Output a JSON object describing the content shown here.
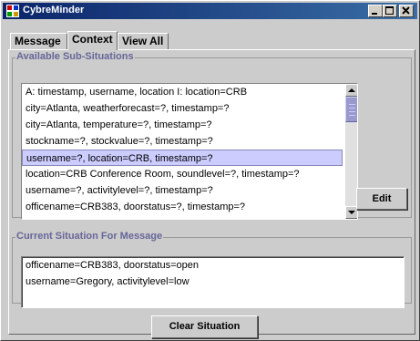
{
  "window": {
    "title": "CybreMinder",
    "icon": "app-logo-icon"
  },
  "tabs": [
    {
      "label": "Message",
      "active": false
    },
    {
      "label": "Context",
      "active": true
    },
    {
      "label": "View All",
      "active": false
    }
  ],
  "available": {
    "title": "Available Sub-Situations",
    "items": [
      "A: timestamp, username, location I: location=CRB",
      "city=Atlanta, weatherforecast=?, timestamp=?",
      "city=Atlanta, temperature=?, timestamp=?",
      "stockname=?, stockvalue=?, timestamp=?",
      "username=?, location=CRB, timestamp=?",
      "location=CRB Conference Room, soundlevel=?, timestamp=?",
      "username=?, activitylevel=?, timestamp=?",
      "officename=CRB383, doorstatus=?, timestamp=?"
    ],
    "selected_index": 4,
    "edit_label": "Edit"
  },
  "current": {
    "title": "Current Situation For Message",
    "lines": [
      "officename=CRB383, doorstatus=open",
      "username=Gregory, activitylevel=low"
    ]
  },
  "clear_label": "Clear Situation",
  "colors": {
    "titlebar_start": "#0a246a",
    "titlebar_end": "#3a6ea5",
    "panel_bg": "#cccccc",
    "groupbox_title": "#666699",
    "selection": "#ccccff",
    "scroll_thumb": "#9999cc"
  }
}
